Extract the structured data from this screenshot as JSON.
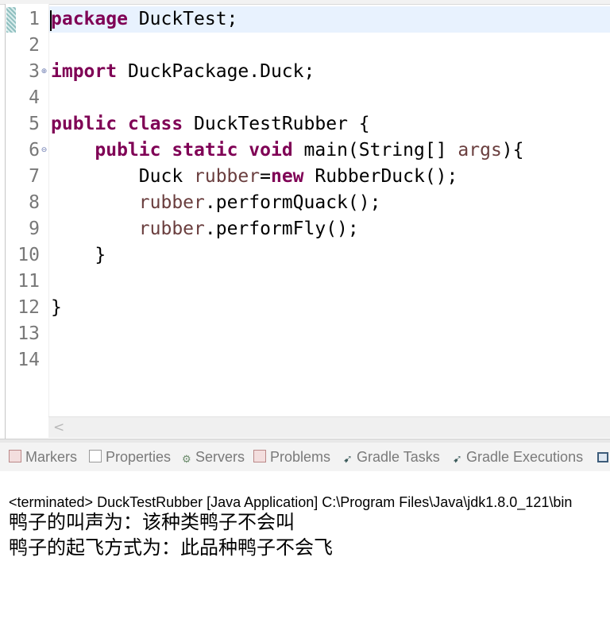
{
  "editor": {
    "line_numbers": [
      "1",
      "2",
      "3",
      "4",
      "5",
      "6",
      "7",
      "8",
      "9",
      "10",
      "11",
      "12",
      "13",
      "14"
    ],
    "code": {
      "l1_kw": "package",
      "l1_rest": " DuckTest;",
      "l3_kw": "import",
      "l3_rest": " DuckPackage.Duck;",
      "l6_kw1": "public",
      "l6_kw2": "class",
      "l6_rest": " DuckTestRubber {",
      "l7_indent": "    ",
      "l7_kw1": "public",
      "l7_kw2": "static",
      "l7_kw3": "void",
      "l7_mid": " main(String[] ",
      "l7_var": "args",
      "l7_end": "){",
      "l8_indent": "        Duck ",
      "l8_var": "rubber",
      "l8_eq": "=",
      "l8_kw": "new",
      "l8_rest": " RubberDuck();",
      "l9_indent": "        ",
      "l9_var": "rubber",
      "l9_rest": ".performQuack();",
      "l10_indent": "        ",
      "l10_var": "rubber",
      "l10_rest": ".performFly();",
      "l11": "    }",
      "l13": "}"
    },
    "fold_icons": {
      "line3": "expand-icon",
      "line7": "collapse-icon"
    },
    "scroll_left_glyph": "<"
  },
  "tabs": [
    {
      "label": "Markers",
      "icon": "markers-icon",
      "color": "#c46a6a"
    },
    {
      "label": "Properties",
      "icon": "properties-icon",
      "color": "#8a8a8a"
    },
    {
      "label": "Servers",
      "icon": "servers-icon",
      "color": "#6a8a6a"
    },
    {
      "label": "Problems",
      "icon": "problems-icon",
      "color": "#c46a6a"
    },
    {
      "label": "Gradle Tasks",
      "icon": "gradle-icon",
      "color": "#4a6a6a"
    },
    {
      "label": "Gradle Executions",
      "icon": "gradle-icon",
      "color": "#4a6a6a"
    }
  ],
  "console": {
    "header": "<terminated> DuckTestRubber [Java Application] C:\\Program Files\\Java\\jdk1.8.0_121\\bin",
    "lines": [
      "鸭子的叫声为：该种类鸭子不会叫",
      "鸭子的起飞方式为：此品种鸭子不会飞"
    ]
  },
  "colors": {
    "keyword": "#7f0055",
    "variable": "#6a3e3e",
    "line_number": "#787878",
    "current_line": "#e8f2fe"
  }
}
